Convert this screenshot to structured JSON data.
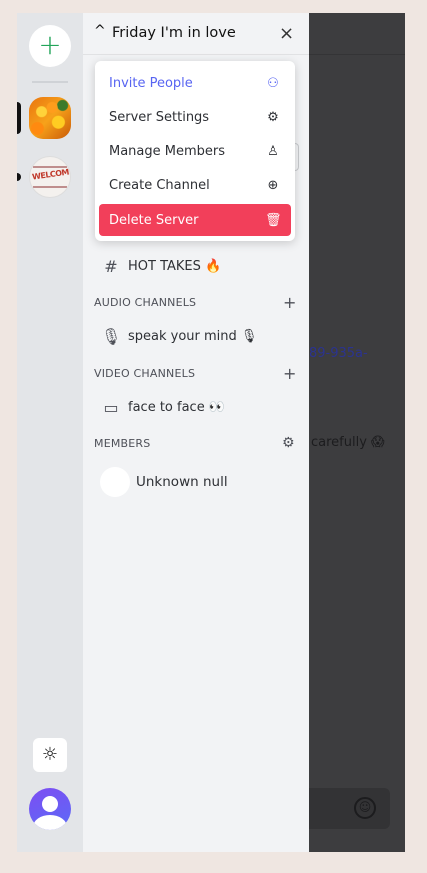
{
  "rail": {
    "add_icon": "+",
    "theme_icon": "☼"
  },
  "server": {
    "name": "Friday I'm in love",
    "chevron": "^",
    "close": "×"
  },
  "menu": {
    "items": [
      {
        "label": "Invite People",
        "icon": "add-user-icon",
        "glyph": "⚇"
      },
      {
        "label": "Server Settings",
        "icon": "gear-icon",
        "glyph": "⚙"
      },
      {
        "label": "Manage Members",
        "icon": "person-icon",
        "glyph": "♙"
      },
      {
        "label": "Create Channel",
        "icon": "plus-circle-icon",
        "glyph": "⊕"
      },
      {
        "label": "Delete Server",
        "icon": "trash-icon",
        "glyph": "🗑"
      }
    ]
  },
  "text_channels": [
    {
      "name": "HOT TAKES 🔥",
      "icon": "#"
    }
  ],
  "audio": {
    "header": "AUDIO CHANNELS",
    "add": "+",
    "channels": [
      {
        "name": "speak your mind 🎙",
        "icon": "🎙"
      }
    ]
  },
  "video": {
    "header": "VIDEO CHANNELS",
    "add": "+",
    "channels": [
      {
        "name": "face to face 👀",
        "icon": "▭"
      }
    ]
  },
  "members": {
    "header": "MEMBERS",
    "gear": "⚙",
    "list": [
      {
        "name": "Unknown null"
      }
    ]
  },
  "chat": {
    "link_fragment": "89-935a-",
    "message_fragment": "carefully 😱",
    "emoji_icon": "☺"
  },
  "colors": {
    "accent": "#5865f2",
    "danger": "#f23f5a",
    "add_server_green": "#23a55a"
  }
}
